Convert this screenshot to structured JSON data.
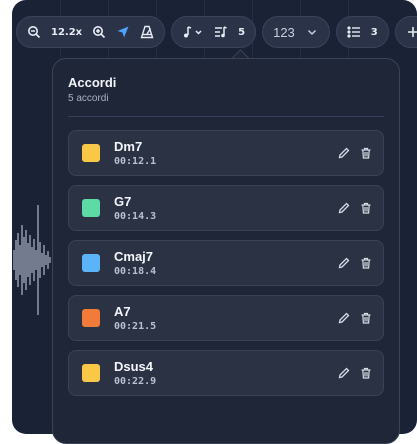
{
  "toolbar": {
    "zoom_level": "12.2x",
    "chord_count": "5",
    "number_format": "123",
    "list_count": "3"
  },
  "popover": {
    "title": "Accordi",
    "subtitle": "5 accordi"
  },
  "chords": [
    {
      "name": "Dm7",
      "time": "00:12.1",
      "color": "#f9c846"
    },
    {
      "name": "G7",
      "time": "00:14.3",
      "color": "#5ddba4"
    },
    {
      "name": "Cmaj7",
      "time": "00:18.4",
      "color": "#5ab4f7"
    },
    {
      "name": "A7",
      "time": "00:21.5",
      "color": "#f27b3a"
    },
    {
      "name": "Dsus4",
      "time": "00:22.9",
      "color": "#f9c846"
    }
  ],
  "icons": {
    "zoom_out": "zoom-out-icon",
    "zoom_in": "zoom-in-icon",
    "cursor": "navigation-arrow-icon",
    "metronome": "metronome-icon",
    "note": "music-note-icon",
    "chords": "chord-list-icon",
    "list": "numbered-list-icon",
    "add": "plus-icon",
    "edit": "pencil-icon",
    "delete": "trash-icon"
  },
  "colors": {
    "accent": "#4ea3ff",
    "background": "#1a2236"
  }
}
